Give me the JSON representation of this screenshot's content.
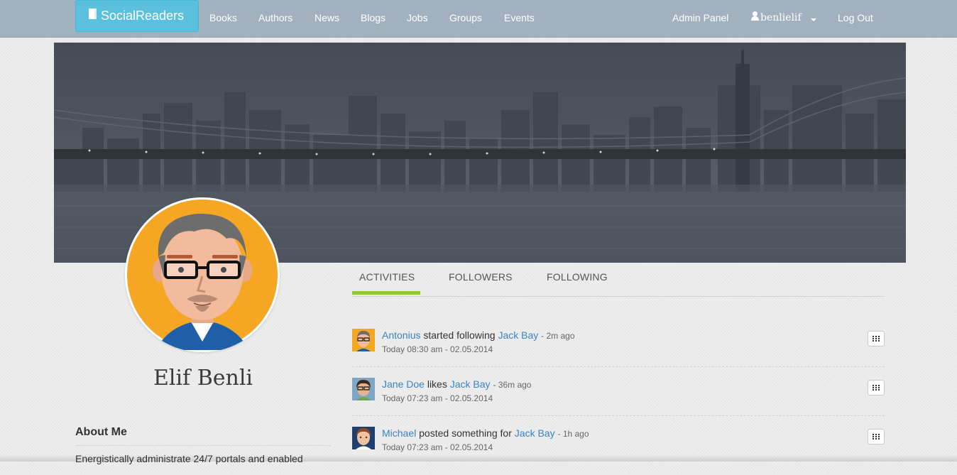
{
  "navbar": {
    "brand": "SocialReaders",
    "links": [
      "Books",
      "Authors",
      "News",
      "Blogs",
      "Jobs",
      "Groups",
      "Events"
    ],
    "admin_panel": "Admin Panel",
    "username": "benlielif",
    "logout": "Log Out"
  },
  "profile": {
    "name": "Elif Benli",
    "about_title": "About Me",
    "about_text": "Energistically administrate 24/7 portals and enabled"
  },
  "tabs": [
    "ACTIVITIES",
    "FOLLOWERS",
    "FOLLOWING"
  ],
  "activities": [
    {
      "actor": "Antonius",
      "verb": "started following",
      "target": "Jack Bay",
      "ago": "- 2m ago",
      "time": "Today 08:30 am - 02.05.2014"
    },
    {
      "actor": "Jane Doe",
      "verb": "likes",
      "target": "Jack Bay",
      "ago": "- 36m ago",
      "time": "Today 07:23 am - 02.05.2014"
    },
    {
      "actor": "Michael",
      "verb": "posted something for",
      "target": "Jack Bay",
      "ago": "- 1h ago",
      "time": "Today 07:23 am - 02.05.2014"
    }
  ],
  "colors": {
    "navbar_bg": "#a2b1bf",
    "brand_bg": "#5bc0de",
    "tab_active": "#8dc63f",
    "link": "#3a83c4",
    "avatar_bg": "#f5a623"
  },
  "icons": {
    "brand": "book-icon",
    "user": "user-icon",
    "caret": "caret-down-icon",
    "activity_action": "grid-icon"
  }
}
